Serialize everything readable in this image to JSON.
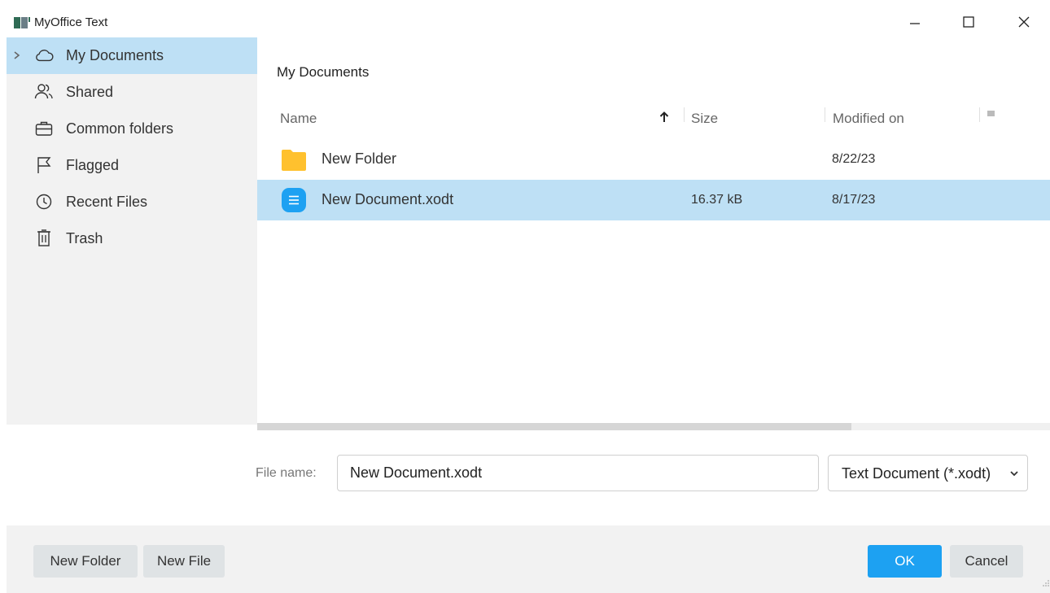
{
  "window": {
    "title": "MyOffice Text",
    "controls": [
      "minimize-icon",
      "maximize-icon",
      "close-icon"
    ]
  },
  "sidebar": {
    "items": [
      {
        "label": "My Documents",
        "icon": "cloud-icon",
        "active": true
      },
      {
        "label": "Shared",
        "icon": "people-icon",
        "active": false
      },
      {
        "label": "Common folders",
        "icon": "briefcase-icon",
        "active": false
      },
      {
        "label": "Flagged",
        "icon": "flag-icon",
        "active": false
      },
      {
        "label": "Recent Files",
        "icon": "clock-icon",
        "active": false
      },
      {
        "label": "Trash",
        "icon": "trash-icon",
        "active": false
      }
    ]
  },
  "main": {
    "breadcrumb": "My Documents",
    "columns": {
      "name": "Name",
      "size": "Size",
      "modified": "Modified on",
      "sort": "ascending"
    },
    "rows": [
      {
        "name": "New Folder",
        "size": "",
        "modified": "8/22/23",
        "icon": "folder-icon",
        "selected": false
      },
      {
        "name": "New Document.xodt",
        "size": "16.37 kB",
        "modified": "8/17/23",
        "icon": "document-icon",
        "selected": true
      }
    ]
  },
  "file_name": {
    "label": "File name:",
    "value": "New Document.xodt"
  },
  "file_type": {
    "selected": "Text Document (*.xodt)"
  },
  "footer": {
    "new_folder": "New Folder",
    "new_file": "New File",
    "ok": "OK",
    "cancel": "Cancel"
  },
  "colors": {
    "selection": "#bee0f5",
    "accent": "#1da1f2",
    "sidebar_bg": "#f2f2f2",
    "folder": "#ffc12e",
    "document": "#1da1f2"
  }
}
